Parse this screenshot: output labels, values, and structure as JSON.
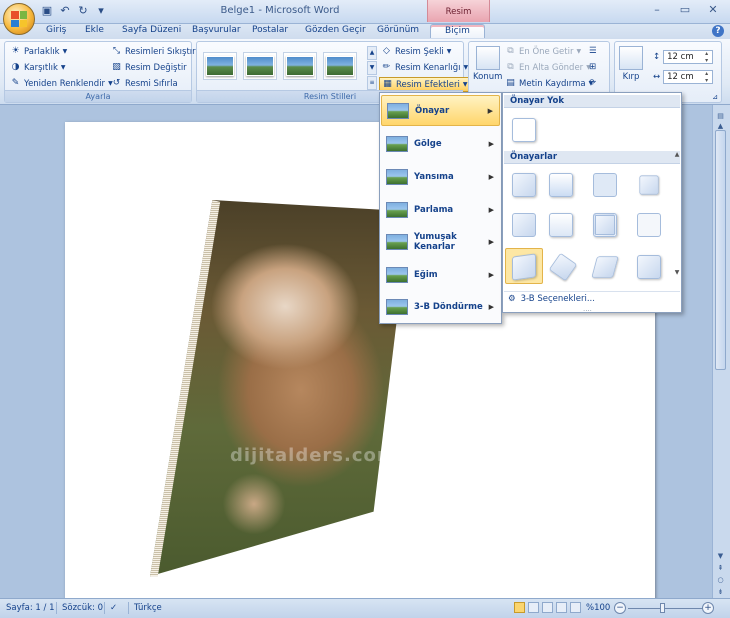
{
  "window": {
    "title": "Belge1 - Microsoft Word",
    "context_tab_header": "Resim Araçları"
  },
  "qat": {
    "save_icon": "save-icon",
    "undo_icon": "undo-icon",
    "redo_icon": "redo-icon"
  },
  "tabs": [
    "Giriş",
    "Ekle",
    "Sayfa Düzeni",
    "Başvurular",
    "Postalar",
    "Gözden Geçir",
    "Görünüm",
    "Biçim"
  ],
  "ribbon": {
    "ayarla": {
      "label": "Ayarla",
      "parlaklik": "Parlaklık",
      "karsitlik": "Karşıtlık",
      "yeniden_renklendir": "Yeniden Renklendir",
      "resimleri_sikistir": "Resimleri Sıkıştır",
      "resim_degistir": "Resim Değiştir",
      "resmi_sifirla": "Resmi Sıfırla"
    },
    "resim_stilleri": {
      "label": "Resim Stilleri",
      "resim_sekli": "Resim Şekli",
      "resim_kenarligi": "Resim Kenarlığı",
      "resim_efektleri": "Resim Efektleri"
    },
    "yerlestir": {
      "konum": "Konum",
      "en_one_getir": "En Öne Getir",
      "en_alta_gonder": "En Alta Gönder",
      "metin_kaydirma": "Metin Kaydırma"
    },
    "boyut": {
      "kirp": "Kırp",
      "height": "12 cm",
      "width": "12 cm"
    }
  },
  "effects_menu": {
    "items": [
      "Önayar",
      "Gölge",
      "Yansıma",
      "Parlama",
      "Yumuşak Kenarlar",
      "Eğim",
      "3-B Döndürme"
    ],
    "active": "Önayar"
  },
  "preset_submenu": {
    "header_none": "Önayar Yok",
    "header_presets": "Önayarlar",
    "footer": "3-B Seçenekleri...",
    "grip": "....",
    "selected_index": 8
  },
  "document": {
    "watermark": "dijitalders.com"
  },
  "statusbar": {
    "page": "Sayfa: 1 / 1",
    "words": "Sözcük: 0",
    "language": "Türkçe",
    "zoom": "%100"
  }
}
